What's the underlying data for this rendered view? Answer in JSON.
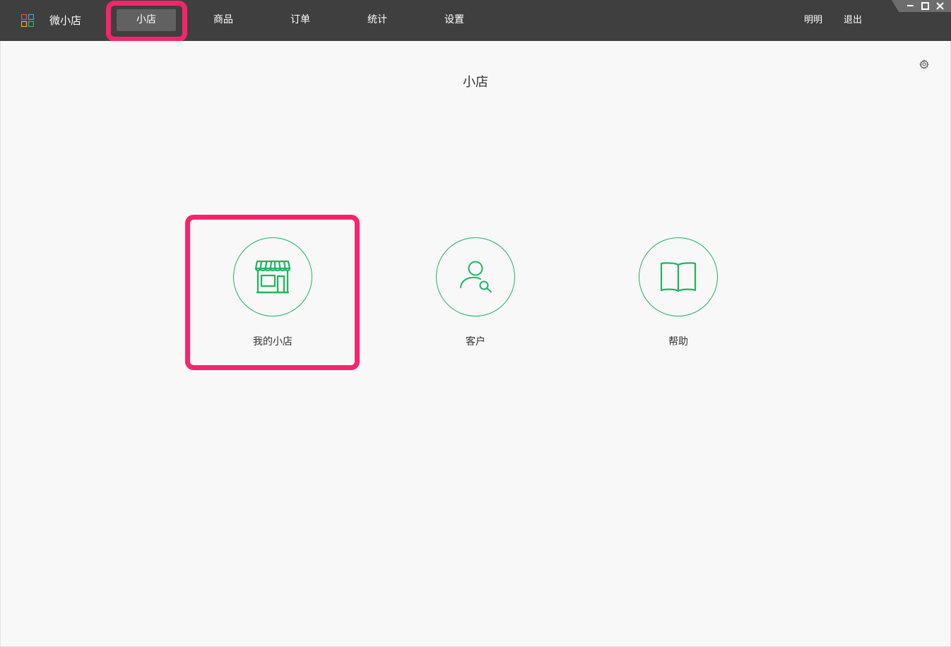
{
  "app": {
    "name": "微小店"
  },
  "nav": {
    "items": [
      {
        "label": "小店",
        "active": true
      },
      {
        "label": "商品",
        "active": false
      },
      {
        "label": "订单",
        "active": false
      },
      {
        "label": "统计",
        "active": false
      },
      {
        "label": "设置",
        "active": false
      }
    ]
  },
  "user": {
    "name": "明明",
    "logout_label": "退出"
  },
  "window_controls": [
    "minimize-icon",
    "maximize-icon",
    "close-icon"
  ],
  "page": {
    "title": "小店",
    "settings_icon": "gear-icon"
  },
  "tiles": [
    {
      "label": "我的小店",
      "icon": "store-icon"
    },
    {
      "label": "客户",
      "icon": "customer-search-icon"
    },
    {
      "label": "帮助",
      "icon": "book-icon"
    }
  ],
  "colors": {
    "topbar": "#3f3f3f",
    "active_nav": "#616161",
    "accent_green": "#1fb462",
    "highlight": "#f7246c",
    "background": "#f8f8f8"
  }
}
